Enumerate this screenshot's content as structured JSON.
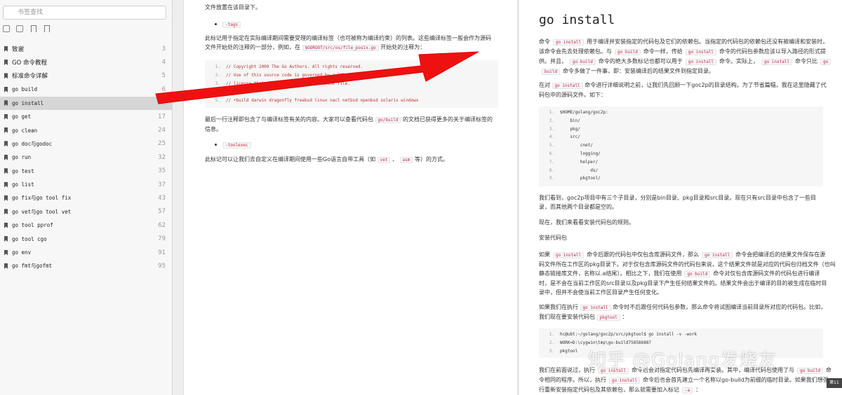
{
  "sidebar": {
    "search_placeholder": "书签查找",
    "items": [
      {
        "label": "致谢",
        "page": "3"
      },
      {
        "label": "GO 命令教程",
        "page": "4"
      },
      {
        "label": "标准命令详解",
        "page": "5"
      },
      {
        "label": "go build",
        "page": "6"
      },
      {
        "label": "go install",
        "page": "12"
      },
      {
        "label": "go get",
        "page": "17"
      },
      {
        "label": "go clean",
        "page": "24"
      },
      {
        "label": "go doc与godoc",
        "page": "25"
      },
      {
        "label": "go run",
        "page": "32"
      },
      {
        "label": "go test",
        "page": "35"
      },
      {
        "label": "go list",
        "page": "37"
      },
      {
        "label": "go fix与go tool fix",
        "page": "43"
      },
      {
        "label": "go vet与go tool vet",
        "page": "57"
      },
      {
        "label": "go tool pprof",
        "page": "62"
      },
      {
        "label": "go tool cgo",
        "page": "79"
      },
      {
        "label": "go env",
        "page": "91"
      },
      {
        "label": "go fmt与gofmt",
        "page": "95"
      }
    ]
  },
  "page_left": {
    "line1": "文件放置在该目录下。",
    "tag1": "-tags",
    "para1a": "此标记用于指定在实际编译期间需要受理的编译标签（也可被称为编译约束）的列表。这些编译标签一般会作为源码",
    "para1b_pre": "文件开始处的注释的一部分，例如，在",
    "para1b_code": "$GOROOT/src/os/file_posix.go",
    "para1b_post": "开始处的注释为：",
    "code": [
      {
        "n": "1.",
        "t": "// Copyright 2009 The Go Authors. All rights reserved."
      },
      {
        "n": "2.",
        "t": "// Use of this source code is governed by a BSD-style"
      },
      {
        "n": "3.",
        "t": "// license that can be found in the LICENSE file."
      },
      {
        "n": "4.",
        "t": ""
      },
      {
        "n": "5.",
        "t": "// +build darwin dragonfly freebsd linux nacl netbsd openbsd solaris windows"
      }
    ],
    "para2a": "最后一行注释即包含了与编译标签有关的内容。大家可以查看代码包",
    "para2_code": "go/build",
    "para2b": "的文档已获得更多的关于编译标签的",
    "para2c": "信息。",
    "tag2": "-toolexec",
    "para3a": "此标记可以让我们去自定义在编译期间使用一些Go语言自带工具（如",
    "para3_c1": "vet",
    "para3_sep": "、",
    "para3_c2": "asm",
    "para3b": "等）的方式。"
  },
  "page_right": {
    "title": "go install",
    "p1": [
      [
        "命令",
        "go install",
        "用于编译并安装指定的代码包及它们的依赖包。当指定的代码包的依赖包还没有被编译和安装时，"
      ],
      [
        "该命令会先去处理依赖包。与",
        "go build",
        "命令一样，传给",
        "go install",
        "命令的代码包参数应该以导入路径的形式提"
      ],
      [
        "供。并且，",
        "go build",
        "命令的绝大多数标记也都可以用于",
        "go install",
        "命令。实际上，",
        "go install",
        "命令只比",
        "go"
      ],
      [
        "build",
        "命令多做了一件事，即：安装编译后的结果文件到指定目录。"
      ]
    ],
    "p2a": "在对",
    "p2_code": "go install",
    "p2b": "命令进行详细说明之前，让我们先回顾一下goc2p的目录结构。为了节省篇幅，我在这里隐藏了代",
    "p2c": "码包中的源码文件。如下：",
    "tree": [
      {
        "n": "1.",
        "t": "$HOME/golang/goc2p:"
      },
      {
        "n": "2.",
        "t": "    bin/"
      },
      {
        "n": "3.",
        "t": "    pkg/"
      },
      {
        "n": "4.",
        "t": "    src/"
      },
      {
        "n": "5.",
        "t": "        cnet/"
      },
      {
        "n": "6.",
        "t": "        logging/"
      },
      {
        "n": "7.",
        "t": "        helper/"
      },
      {
        "n": "8.",
        "t": "            ds/"
      },
      {
        "n": "9.",
        "t": "        pkgtool/"
      }
    ],
    "p3a": "我们看到，goc2p项目中有三个子目录，分别是bin目录、pkg目录和src目录。现在只有src目录中包含了一些目",
    "p3b": "录，而其他两个目录都是空的。",
    "p4": "现在，我们来看看安装代码包的规则。",
    "p5": "安装代码包",
    "p6": [
      [
        "如果",
        "go install",
        "命令后跟的代码包中仅包含库源码文件，那么",
        "go install",
        "命令会把编译后的结果文件保存在源"
      ],
      [
        "码文件所在工作区的pkg目录下。对于仅包含库源码文件的代码包来说，这个结果文件就是对应的代码包归档文件（也叫"
      ],
      [
        "静态链接库文件，名称以.a结尾）。相比之下，我们在使用",
        "go build",
        "命令对仅包含库源码文件的代码包进行编译"
      ],
      [
        "时，是不会在当前工作区的src目录以及pkg目录下产生任何结果文件的。结果文件会出于编译的目的被生成在临时目"
      ],
      [
        "录中，但并不会使当前工作区目录产生任何变化。"
      ]
    ],
    "p7a": "如果我们在执行",
    "p7_code": "go install",
    "p7b": "命令时不后跟任何代码包参数，那么命令将试图编译当前目录所对应的代码包。比如，",
    "p7c": "我们现在要安装代码包",
    "p7_code2": "pkgtool",
    "p7d": "：",
    "term": [
      {
        "n": "1.",
        "t": "hc@ubt:~/golang/goc2p/src/pkgtool$ go install -v -work"
      },
      {
        "n": "2.",
        "t": "WORK=D:\\cygwin\\tmp\\go-build758586887"
      },
      {
        "n": "3.",
        "t": "pkgtool"
      }
    ],
    "p8": [
      [
        "我们在前面说过，执行",
        "go install",
        "命令后会对指定代码包先编译再安装。其中，编译代码包使用了与",
        "go build",
        "命"
      ],
      [
        "令相同的程序。所以，执行",
        "go install",
        "命令后也会首先建立一个名称以go-build为前缀的临时目录。如果我们想强"
      ],
      [
        "行重新安装指定代码包及其依赖包，那么就需要加入标记",
        "-a",
        "："
      ]
    ]
  },
  "watermark": "知乎 @Golang发烧友",
  "corner_text": "第11"
}
